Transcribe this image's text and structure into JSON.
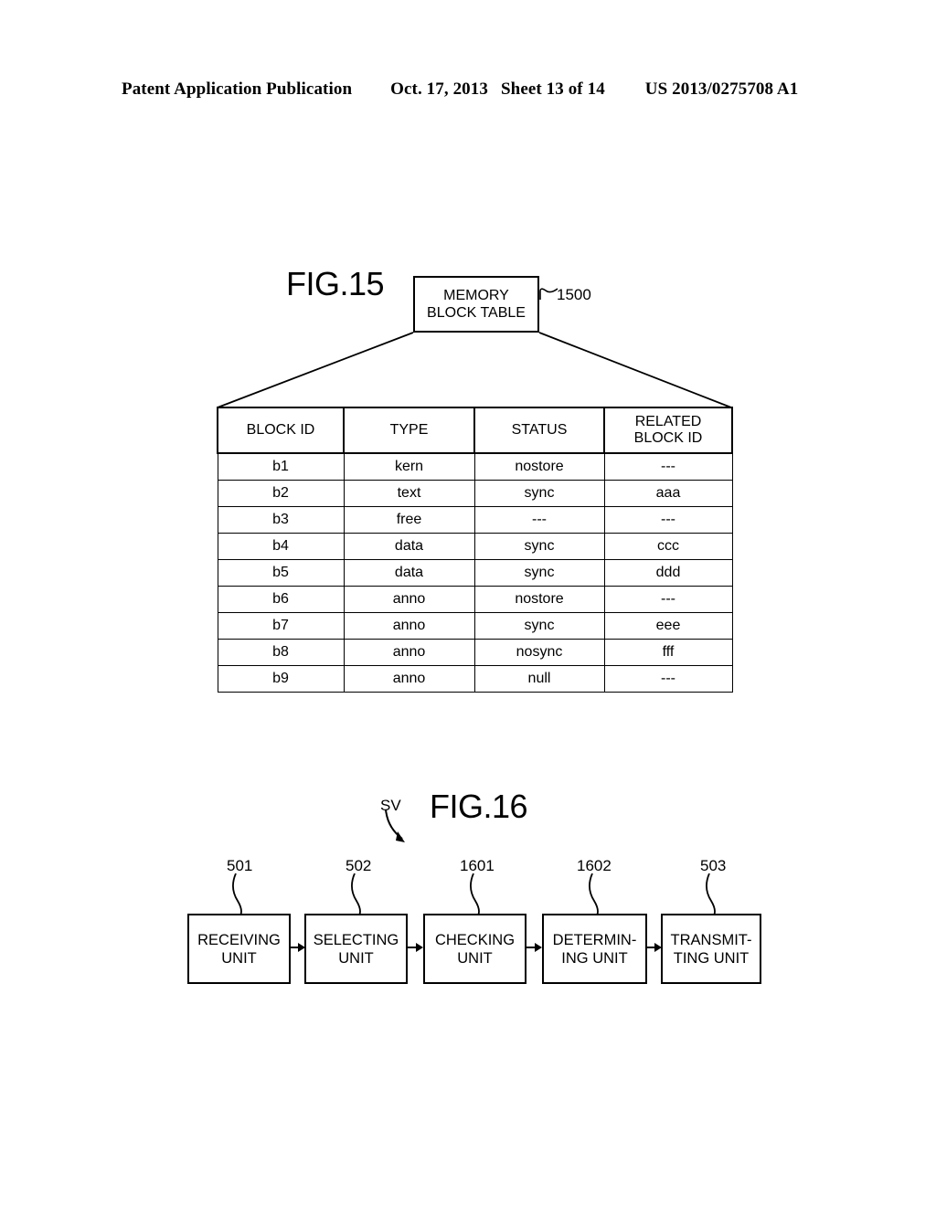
{
  "header": {
    "publication": "Patent Application Publication",
    "date": "Oct. 17, 2013",
    "sheet": "Sheet 13 of 14",
    "patent_number": "US 2013/0275708 A1"
  },
  "fig15": {
    "label": "FIG.15",
    "title_box": "MEMORY\nBLOCK TABLE",
    "title_box_line1": "MEMORY",
    "title_box_line2": "BLOCK TABLE",
    "reference": "1500",
    "table": {
      "columns": [
        {
          "line1": "BLOCK ID",
          "line2": ""
        },
        {
          "line1": "TYPE",
          "line2": ""
        },
        {
          "line1": "STATUS",
          "line2": ""
        },
        {
          "line1": "RELATED",
          "line2": "BLOCK ID"
        }
      ],
      "rows": [
        {
          "block_id": "b1",
          "type": "kern",
          "status": "nostore",
          "related_block_id": "---"
        },
        {
          "block_id": "b2",
          "type": "text",
          "status": "sync",
          "related_block_id": "aaa"
        },
        {
          "block_id": "b3",
          "type": "free",
          "status": "---",
          "related_block_id": "---"
        },
        {
          "block_id": "b4",
          "type": "data",
          "status": "sync",
          "related_block_id": "ccc"
        },
        {
          "block_id": "b5",
          "type": "data",
          "status": "sync",
          "related_block_id": "ddd"
        },
        {
          "block_id": "b6",
          "type": "anno",
          "status": "nostore",
          "related_block_id": "---"
        },
        {
          "block_id": "b7",
          "type": "anno",
          "status": "sync",
          "related_block_id": "eee"
        },
        {
          "block_id": "b8",
          "type": "anno",
          "status": "nosync",
          "related_block_id": "fff"
        },
        {
          "block_id": "b9",
          "type": "anno",
          "status": "null",
          "related_block_id": "---"
        }
      ]
    }
  },
  "fig16": {
    "label": "FIG.16",
    "system_label": "SV",
    "units": [
      {
        "reference": "501",
        "label": "RECEIVING\nUNIT"
      },
      {
        "reference": "502",
        "label": "SELECTING\nUNIT"
      },
      {
        "reference": "1601",
        "label": "CHECKING\nUNIT"
      },
      {
        "reference": "1602",
        "label": "DETERMIN-\nING UNIT"
      },
      {
        "reference": "503",
        "label": "TRANSMIT-\nTING UNIT"
      }
    ]
  },
  "colors": {
    "ink": "#000000",
    "paper": "#ffffff"
  }
}
